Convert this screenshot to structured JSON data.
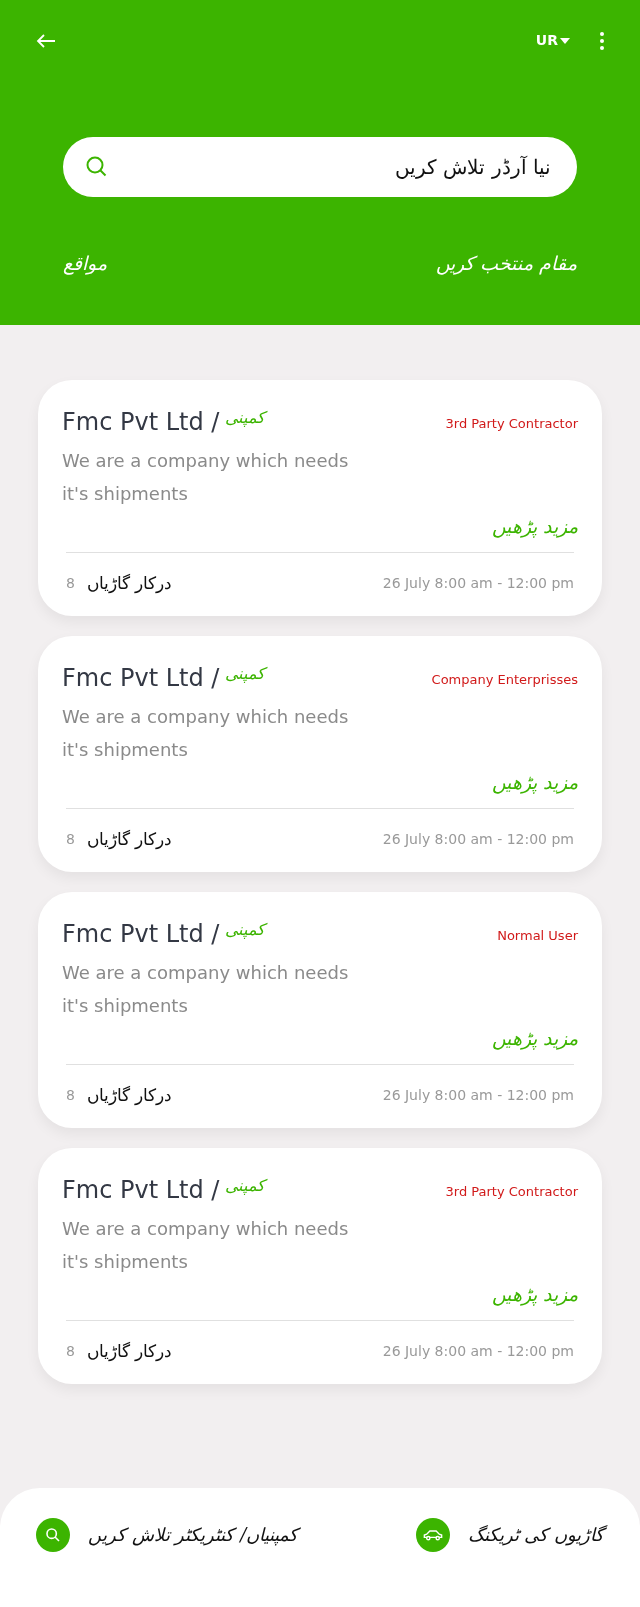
{
  "header": {
    "language": "UR",
    "search": {
      "placeholder": "نیا آرڈر تلاش کریں"
    },
    "select_location": "مقام منتخب کریں",
    "locations": "مواقع"
  },
  "cards": [
    {
      "company": "Fmc Pvt Ltd /",
      "company_tag": "کمپنی",
      "type": "3rd Party Contractor",
      "description": "We are a company which needs it's shipments",
      "read_more": "مزید پڑھیں",
      "vehicles_label": "درکار گاڑیاں",
      "vehicles_count": "8",
      "schedule": "26 July 8:00 am - 12:00 pm"
    },
    {
      "company": "Fmc Pvt Ltd /",
      "company_tag": "کمپنی",
      "type": "Company Enterprisses",
      "description": "We are a company which needs it's shipments",
      "read_more": "مزید پڑھیں",
      "vehicles_label": "درکار گاڑیاں",
      "vehicles_count": "8",
      "schedule": "26 July 8:00 am - 12:00 pm"
    },
    {
      "company": "Fmc Pvt Ltd /",
      "company_tag": "کمپنی",
      "type": "Normal User",
      "description": "We are a company which needs it's shipments",
      "read_more": "مزید پڑھیں",
      "vehicles_label": "درکار گاڑیاں",
      "vehicles_count": "8",
      "schedule": "26 July 8:00 am - 12:00 pm"
    },
    {
      "company": "Fmc Pvt Ltd /",
      "company_tag": "کمپنی",
      "type": "3rd Party Contractor",
      "description": "We are a company which needs it's shipments",
      "read_more": "مزید پڑھیں",
      "vehicles_label": "درکار گاڑیاں",
      "vehicles_count": "8",
      "schedule": "26 July 8:00 am - 12:00 pm"
    }
  ],
  "bottom_nav": [
    {
      "kind": "car",
      "label": "گاڑیوں کی ٹریکنگ"
    },
    {
      "kind": "search",
      "label": "کمپنیاں/ کنٹریکٹر تلاش کریں"
    }
  ]
}
